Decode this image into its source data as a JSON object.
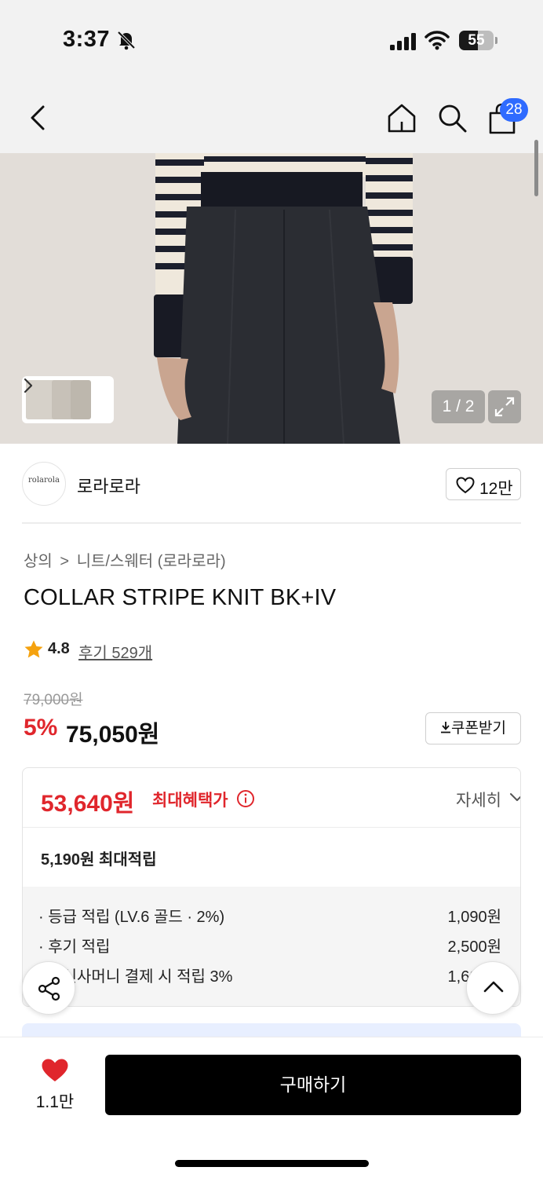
{
  "status_bar": {
    "time": "3:37",
    "battery_level": "55",
    "battery_fraction": 0.55
  },
  "nav": {
    "cart_count": "28"
  },
  "gallery": {
    "page_counter": "1 / 2",
    "current_page": 1,
    "total_pages": 2
  },
  "brand": {
    "logo_text": "rolarola",
    "name": "로라로라",
    "like_count": "12만"
  },
  "product": {
    "breadcrumb": [
      "상의",
      "니트/스웨터 (로라로라)"
    ],
    "breadcrumb_separator": ">",
    "title": "COLLAR STRIPE KNIT BK+IV",
    "rating": "4.8",
    "review_link": "후기 529개",
    "original_price": "79,000원",
    "discount_rate": "5%",
    "sale_price": "75,050원",
    "coupon_label": "쿠폰받기"
  },
  "benefit": {
    "max_price": "53,640원",
    "max_label": "최대혜택가",
    "detail_toggle": "자세히",
    "point_summary": "5,190원 최대적립",
    "points": [
      {
        "label": "· 등급 적립 (LV.6 골드 · 2%)",
        "value": "1,090원"
      },
      {
        "label": "· 후기 적립",
        "value": "2,500원"
      },
      {
        "label": "· 무신사머니 결제 시 적립 3%",
        "value": "1,600원"
      }
    ]
  },
  "bottom_bar": {
    "wish_count": "1.1만",
    "buy_label": "구매하기"
  },
  "colors": {
    "accent_red": "#e0262c",
    "badge_blue": "#2f6bff",
    "buy_button": "#000000"
  }
}
